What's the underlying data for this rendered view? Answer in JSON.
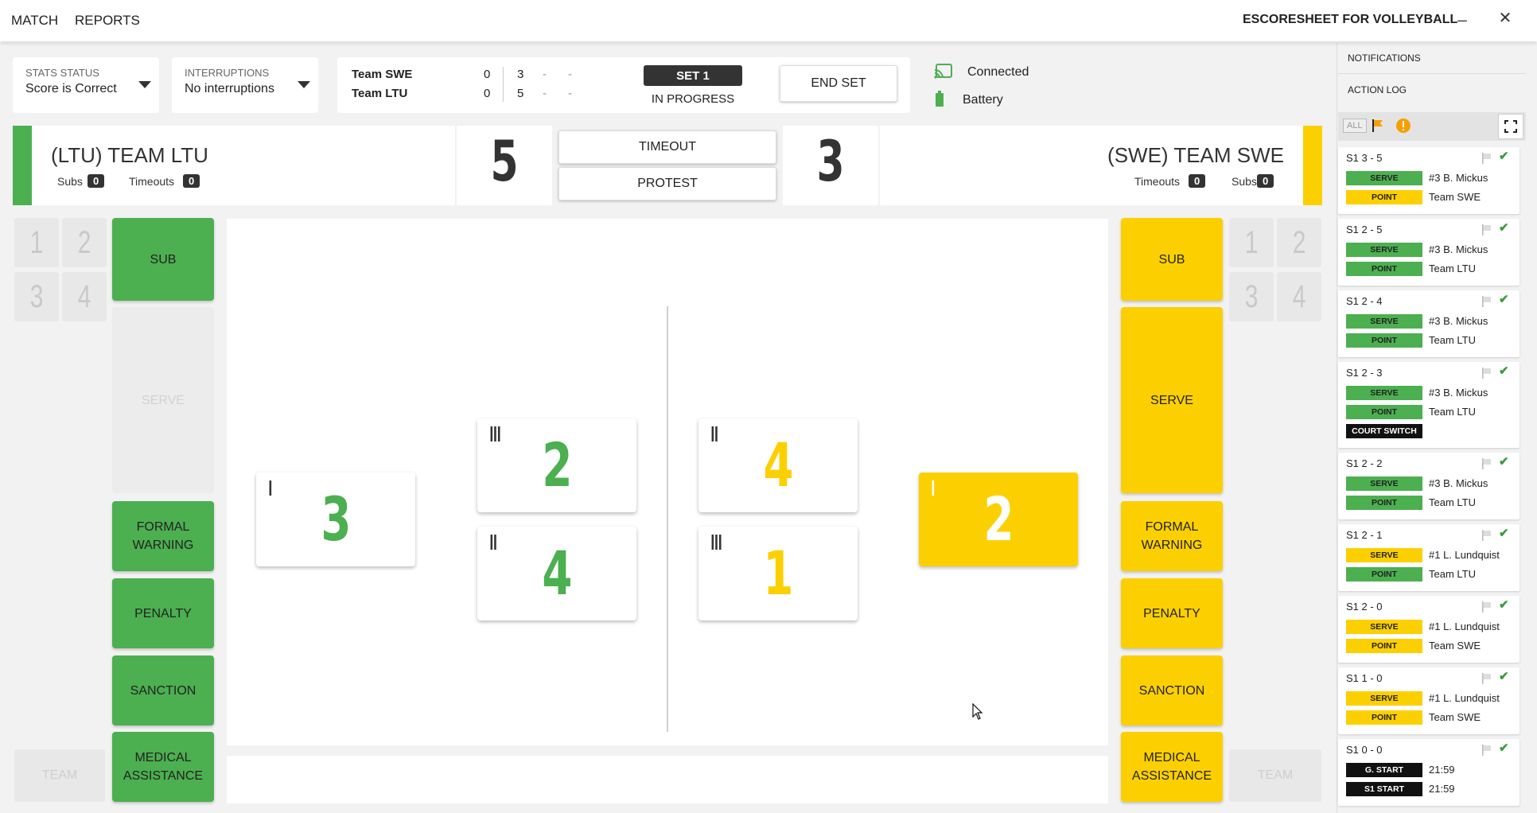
{
  "menu": {
    "match": "MATCH",
    "reports": "REPORTS"
  },
  "app_title": "ESCORESHEET FOR VOLLEYBALL",
  "window": {
    "minimize": "_",
    "close": "✕"
  },
  "stats_status": {
    "label": "STATS STATUS",
    "value": "Score is Correct"
  },
  "interruptions": {
    "label": "INTERRUPTIONS",
    "value": "No interruptions"
  },
  "scoreboard": {
    "rows": [
      {
        "team": "Team SWE",
        "sets": "0",
        "s1": "3",
        "s2": "-",
        "s3": "-"
      },
      {
        "team": "Team LTU",
        "sets": "0",
        "s1": "5",
        "s2": "-",
        "s3": "-"
      }
    ],
    "set_label": "SET 1",
    "set_status": "IN PROGRESS",
    "end_set": "END SET"
  },
  "connection": {
    "status": "Connected",
    "battery": "Battery"
  },
  "left_team": {
    "name": "(LTU) TEAM LTU",
    "subs_label": "Subs",
    "subs": "0",
    "timeouts_label": "Timeouts",
    "timeouts": "0",
    "score": "5",
    "color": "#4caf50"
  },
  "right_team": {
    "name": "(SWE) TEAM SWE",
    "subs_label": "Subs",
    "subs": "0",
    "timeouts_label": "Timeouts",
    "timeouts": "0",
    "score": "3",
    "color": "#fcd000"
  },
  "center_buttons": {
    "timeout": "TIMEOUT",
    "protest": "PROTEST"
  },
  "bench_numbers": [
    "1",
    "2",
    "3",
    "4"
  ],
  "actions": {
    "sub": "SUB",
    "serve": "SERVE",
    "formal_warning": "FORMAL WARNING",
    "penalty": "PENALTY",
    "sanction": "SANCTION",
    "medical": "MEDICAL ASSISTANCE",
    "team": "TEAM"
  },
  "court": {
    "left": [
      {
        "roman": "I",
        "number": "3"
      },
      {
        "roman": "III",
        "number": "2"
      },
      {
        "roman": "II",
        "number": "4"
      }
    ],
    "right": [
      {
        "roman": "II",
        "number": "4"
      },
      {
        "roman": "III",
        "number": "1"
      },
      {
        "roman": "I",
        "number": "2"
      }
    ]
  },
  "right_panel": {
    "notifications": "NOTIFICATIONS",
    "action_log": "ACTION LOG",
    "filter_all": "ALL"
  },
  "log": [
    {
      "title": "S1  3 - 5",
      "tags": [
        {
          "tag": "SERVE",
          "color": "g",
          "text": "#3 B. Mickus"
        },
        {
          "tag": "POINT",
          "color": "y",
          "text": "Team SWE"
        }
      ]
    },
    {
      "title": "S1  2 - 5",
      "tags": [
        {
          "tag": "SERVE",
          "color": "g",
          "text": "#3 B. Mickus"
        },
        {
          "tag": "POINT",
          "color": "g",
          "text": "Team LTU"
        }
      ]
    },
    {
      "title": "S1  2 - 4",
      "tags": [
        {
          "tag": "SERVE",
          "color": "g",
          "text": "#3 B. Mickus"
        },
        {
          "tag": "POINT",
          "color": "g",
          "text": "Team LTU"
        }
      ]
    },
    {
      "title": "S1  2 - 3",
      "tags": [
        {
          "tag": "SERVE",
          "color": "g",
          "text": "#3 B. Mickus"
        },
        {
          "tag": "POINT",
          "color": "g",
          "text": "Team LTU"
        },
        {
          "tag": "COURT SWITCH",
          "color": "b",
          "text": ""
        }
      ]
    },
    {
      "title": "S1  2 - 2",
      "tags": [
        {
          "tag": "SERVE",
          "color": "g",
          "text": "#3 B. Mickus"
        },
        {
          "tag": "POINT",
          "color": "g",
          "text": "Team LTU"
        }
      ]
    },
    {
      "title": "S1  2 - 1",
      "tags": [
        {
          "tag": "SERVE",
          "color": "y",
          "text": "#1 L. Lundquist"
        },
        {
          "tag": "POINT",
          "color": "g",
          "text": "Team LTU"
        }
      ]
    },
    {
      "title": "S1  2 - 0",
      "tags": [
        {
          "tag": "SERVE",
          "color": "y",
          "text": "#1 L. Lundquist"
        },
        {
          "tag": "POINT",
          "color": "y",
          "text": "Team SWE"
        }
      ]
    },
    {
      "title": "S1  1 - 0",
      "tags": [
        {
          "tag": "SERVE",
          "color": "y",
          "text": "#1 L. Lundquist"
        },
        {
          "tag": "POINT",
          "color": "y",
          "text": "Team SWE"
        }
      ]
    },
    {
      "title": "S1  0 - 0",
      "tags": [
        {
          "tag": "G. START",
          "color": "b",
          "text": "21:59"
        },
        {
          "tag": "S1 START",
          "color": "b",
          "text": "21:59"
        }
      ]
    }
  ]
}
